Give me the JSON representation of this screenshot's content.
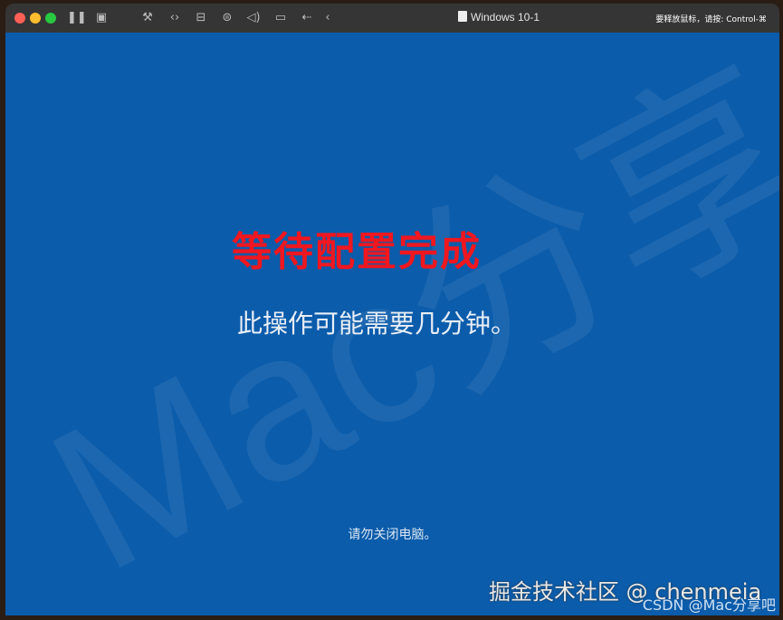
{
  "window": {
    "title": "Windows 10-1",
    "release_hint": "要释放鼠标，请按: Control-⌘"
  },
  "toolbar": {
    "icons": [
      "pause-icon",
      "snapshot-icon",
      "settings-wrench-icon",
      "code-icon",
      "drive-icon",
      "printer-icon",
      "sound-icon",
      "camera-icon",
      "usb-icon",
      "back-chevron-icon"
    ]
  },
  "screen": {
    "annotation": "等待配置完成",
    "message": "此操作可能需要几分钟。",
    "footer": "请勿关闭电脑。",
    "watermark_bg": "Mac分享",
    "watermark_juejin": "掘金技术社区 @ chenmeia",
    "watermark_csdn": "CSDN @Mac分享吧"
  },
  "colors": {
    "background": "#0b5cab",
    "annotation": "#f0171f"
  }
}
